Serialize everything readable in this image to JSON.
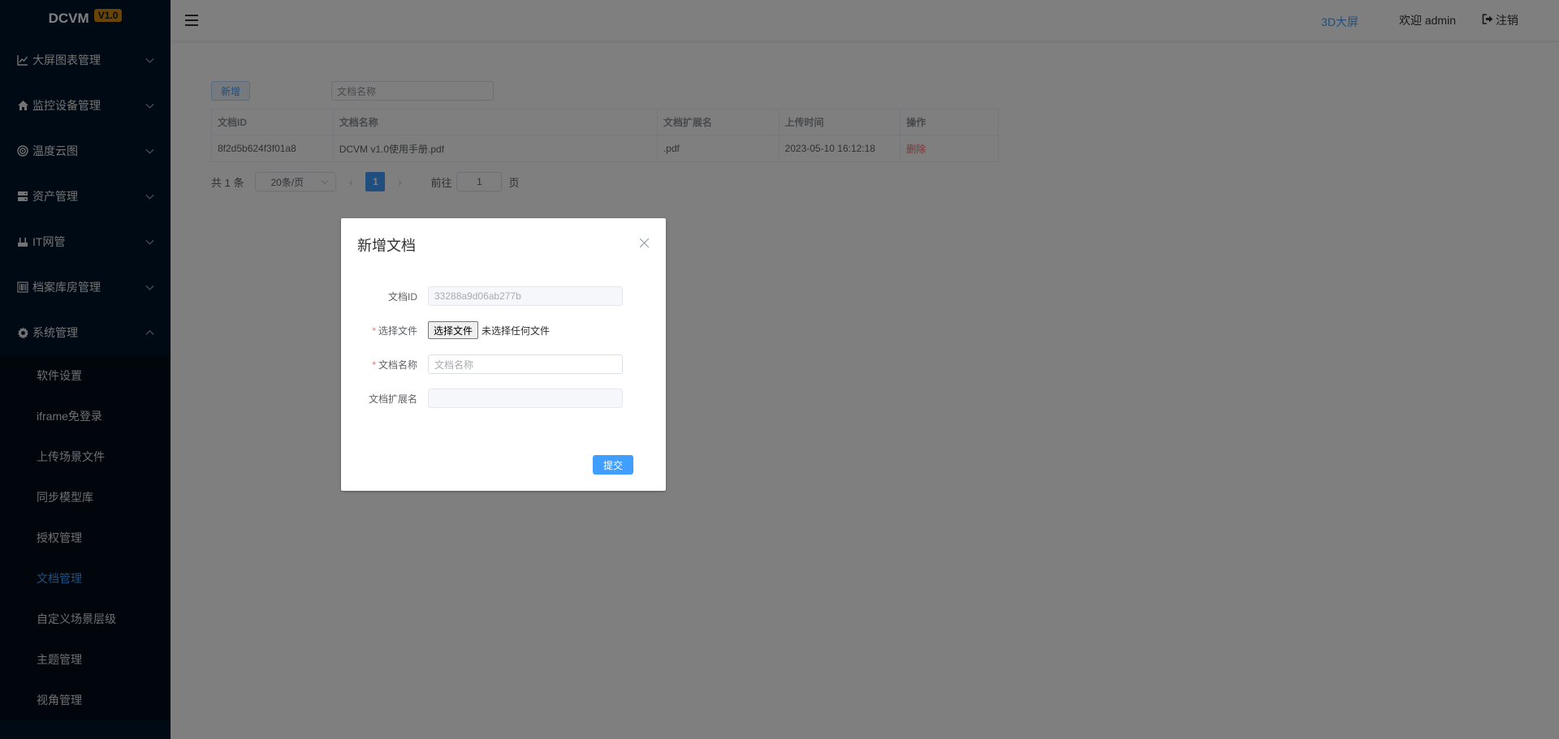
{
  "app": {
    "logo_text": "DCVM",
    "version": "V1.0"
  },
  "sidebar": {
    "items": [
      {
        "label": "大屏图表管理",
        "icon": "chart-line-icon",
        "expanded": false
      },
      {
        "label": "监控设备管理",
        "icon": "home-icon",
        "expanded": false
      },
      {
        "label": "温度云图",
        "icon": "target-icon",
        "expanded": false
      },
      {
        "label": "资产管理",
        "icon": "server-icon",
        "expanded": false
      },
      {
        "label": "IT网管",
        "icon": "network-icon",
        "expanded": false
      },
      {
        "label": "档案库房管理",
        "icon": "barcode-icon",
        "expanded": false
      },
      {
        "label": "系统管理",
        "icon": "gear-icon",
        "expanded": true
      }
    ],
    "submenu": [
      {
        "label": "软件设置"
      },
      {
        "label": "iframe免登录"
      },
      {
        "label": "上传场景文件"
      },
      {
        "label": "同步模型库"
      },
      {
        "label": "授权管理"
      },
      {
        "label": "文档管理",
        "active": true
      },
      {
        "label": "自定义场景层级"
      },
      {
        "label": "主题管理"
      },
      {
        "label": "视角管理"
      }
    ]
  },
  "header": {
    "link_3d": "3D大屏",
    "welcome": "欢迎 admin",
    "logout": "注销"
  },
  "toolbar": {
    "add_label": "新增",
    "search_placeholder": "文档名称"
  },
  "table": {
    "columns": [
      "文档ID",
      "文档名称",
      "文档扩展名",
      "上传时间",
      "操作"
    ],
    "rows": [
      {
        "id": "8f2d5b624f3f01a8",
        "name": "DCVM v1.0使用手册.pdf",
        "ext": ".pdf",
        "time": "2023-05-10 16:12:18",
        "action": "删除"
      }
    ]
  },
  "pagination": {
    "total": "共 1 条",
    "page_size": "20条/页",
    "current_page": "1",
    "goto_label": "前往",
    "goto_value": "1",
    "page_unit": "页"
  },
  "dialog": {
    "title": "新增文档",
    "fields": {
      "doc_id_label": "文档ID",
      "doc_id_value": "33288a9d06ab277b",
      "file_label": "选择文件",
      "file_button": "选择文件",
      "file_status": "未选择任何文件",
      "name_label": "文档名称",
      "name_placeholder": "文档名称",
      "ext_label": "文档扩展名",
      "ext_value": ""
    },
    "submit_label": "提交"
  }
}
